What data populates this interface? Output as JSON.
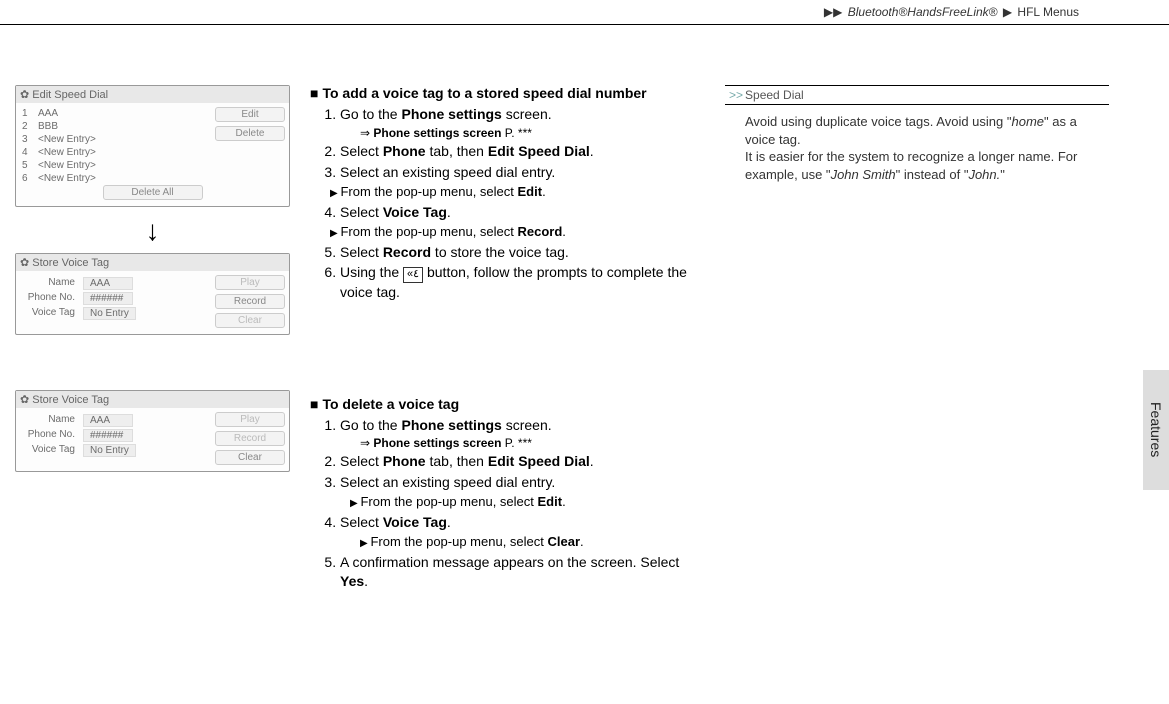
{
  "header": {
    "path_prefix": "▶▶",
    "product": "Bluetooth®HandsFreeLink®",
    "sep": "▶",
    "section": "HFL Menus"
  },
  "side_tab": "Features",
  "screenshots": {
    "edit_speed_dial": {
      "title": "Edit Speed Dial",
      "rows": [
        {
          "n": "1",
          "label": "AAA"
        },
        {
          "n": "2",
          "label": "BBB"
        },
        {
          "n": "3",
          "label": "<New Entry>"
        },
        {
          "n": "4",
          "label": "<New Entry>"
        },
        {
          "n": "5",
          "label": "<New Entry>"
        },
        {
          "n": "6",
          "label": "<New Entry>"
        }
      ],
      "buttons": {
        "edit": "Edit",
        "delete": "Delete",
        "delete_all": "Delete All"
      }
    },
    "store_voice_tag_1": {
      "title": "Store Voice Tag",
      "fields": {
        "name_lbl": "Name",
        "name_val": "AAA",
        "phone_lbl": "Phone No.",
        "phone_val": "######",
        "tag_lbl": "Voice Tag",
        "tag_val": "No Entry"
      },
      "buttons": {
        "play": "Play",
        "record": "Record",
        "clear": "Clear"
      }
    },
    "store_voice_tag_2": {
      "title": "Store Voice Tag",
      "fields": {
        "name_lbl": "Name",
        "name_val": "AAA",
        "phone_lbl": "Phone No.",
        "phone_val": "######",
        "tag_lbl": "Voice Tag",
        "tag_val": "No Entry"
      },
      "buttons": {
        "play": "Play",
        "record": "Record",
        "clear": "Clear"
      }
    }
  },
  "sections": {
    "add": {
      "title": "To add a voice tag to a stored speed dial number",
      "step1_a": "Go to the ",
      "step1_b": "Phone settings",
      "step1_c": " screen.",
      "ref_a": "Phone settings screen",
      "ref_b": " P. ***",
      "step2_a": "Select ",
      "step2_b": "Phone",
      "step2_c": " tab, then ",
      "step2_d": "Edit Speed Dial",
      "step2_e": ".",
      "step3": "Select an existing speed dial entry.",
      "sub3_a": "From the pop-up menu, select ",
      "sub3_b": "Edit",
      "sub3_c": ".",
      "step4_a": "Select ",
      "step4_b": "Voice Tag",
      "step4_c": ".",
      "sub4_a": "From the pop-up menu, select ",
      "sub4_b": "Record",
      "sub4_c": ".",
      "step5_a": "Select ",
      "step5_b": "Record",
      "step5_c": " to store the voice tag.",
      "step6_a": "Using the ",
      "step6_icon": "«٤",
      "step6_b": " button, follow the prompts to complete the voice tag."
    },
    "del": {
      "title": "To delete a voice tag",
      "step1_a": "Go to the ",
      "step1_b": "Phone settings",
      "step1_c": " screen.",
      "ref_a": "Phone settings screen",
      "ref_b": " P. ***",
      "step2_a": "Select ",
      "step2_b": "Phone",
      "step2_c": " tab, then ",
      "step2_d": "Edit Speed Dial",
      "step2_e": ".",
      "step3": "Select an existing speed dial entry.",
      "sub3_a": "From the pop-up menu, select ",
      "sub3_b": "Edit",
      "sub3_c": ".",
      "step4_a": "Select ",
      "step4_b": "Voice Tag",
      "step4_c": ".",
      "sub4_a": "From the pop-up menu, select ",
      "sub4_b": "Clear",
      "sub4_c": ".",
      "step5_a": "A confirmation message appears on the screen. Select ",
      "step5_b": "Yes",
      "step5_c": "."
    }
  },
  "tips": {
    "head_gt": ">>",
    "head": "Speed Dial",
    "p1_a": "Avoid using duplicate voice tags. Avoid using \"",
    "p1_b": "home",
    "p1_c": "\" as a voice tag.",
    "p2_a": "It is easier for the system to recognize a longer name. For example, use \"",
    "p2_b": "John Smith",
    "p2_c": "\" instead of \"",
    "p2_d": "John.",
    "p2_e": "\""
  }
}
